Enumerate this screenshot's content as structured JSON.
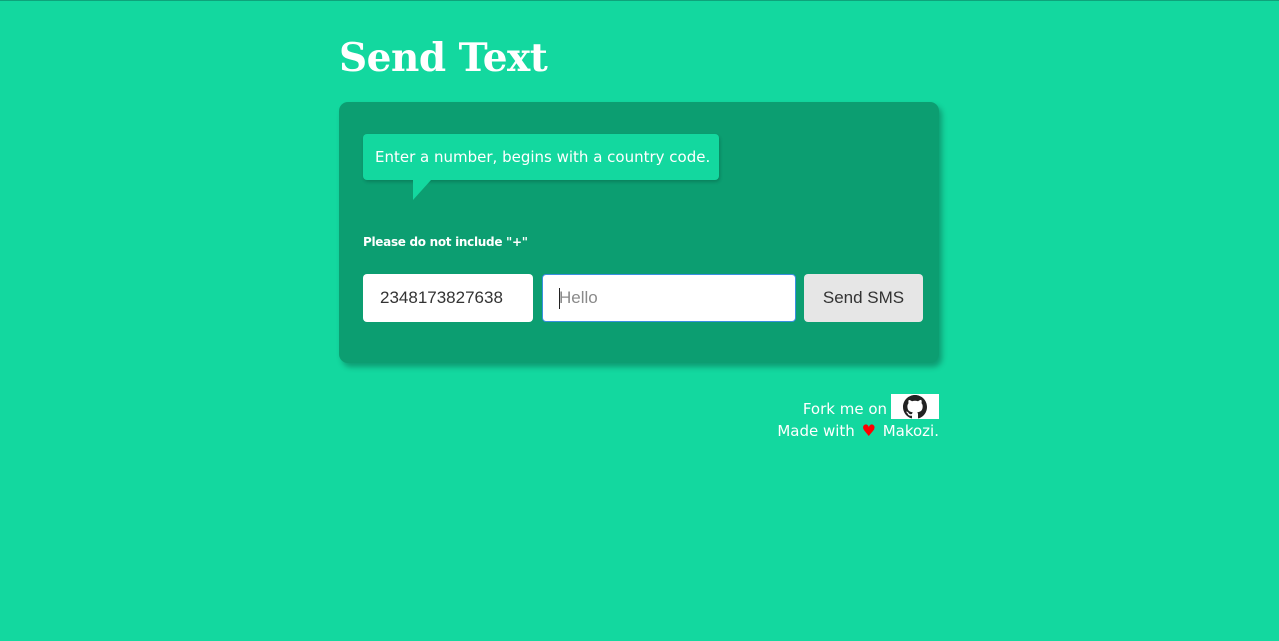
{
  "page": {
    "title": "Send Text",
    "background_color": "#13d89f",
    "card_color": "#0c9e71"
  },
  "form": {
    "tooltip_text": "Enter a number, begins with a country code.",
    "hint_text": "Please do not include \"+\"",
    "phone_value": "2348173827638",
    "message_placeholder": "Hello",
    "message_value": "",
    "send_label": "Send SMS"
  },
  "footer": {
    "fork_text": "Fork me on",
    "github_icon": "github-icon",
    "made_with_text": "Made with",
    "heart_icon": "heart-icon",
    "author_text": "Makozi."
  }
}
